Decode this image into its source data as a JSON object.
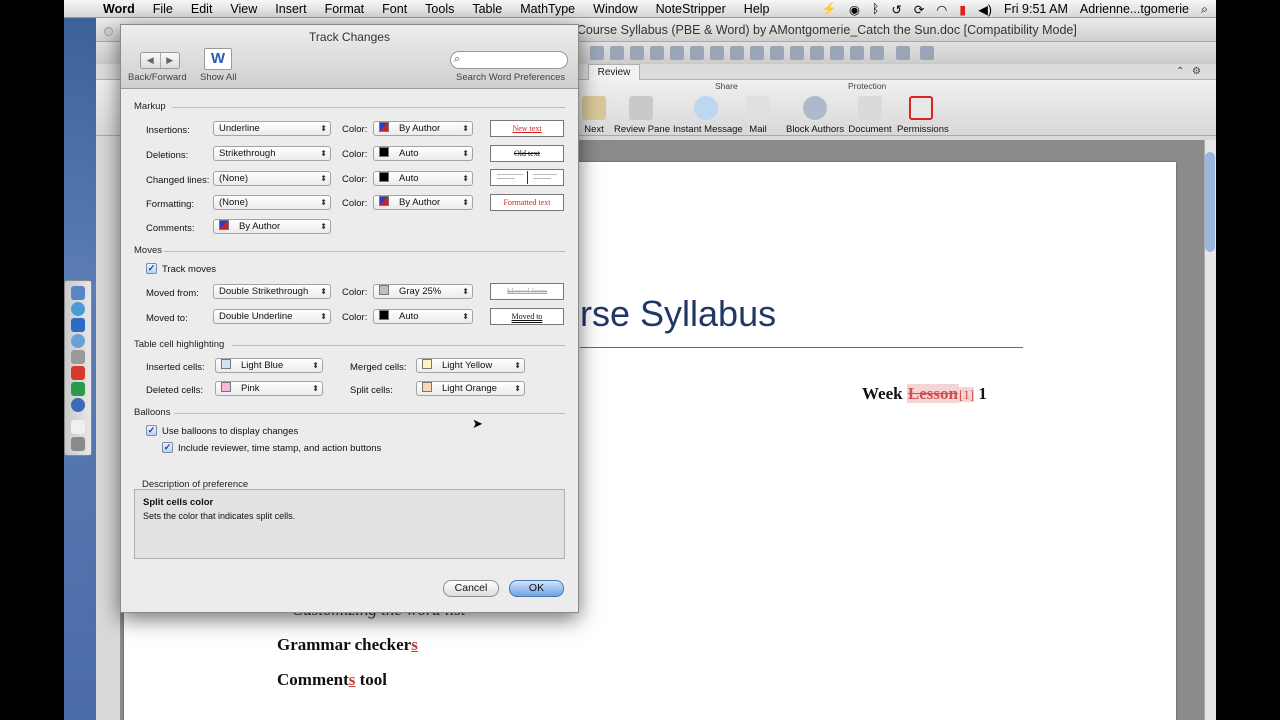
{
  "menubar": {
    "apple": "",
    "app": "Word",
    "items": [
      "File",
      "Edit",
      "View",
      "Insert",
      "Format",
      "Font",
      "Tools",
      "Table",
      "MathType",
      "Window",
      "NoteStripper",
      "Help"
    ],
    "clock": "Fri 9:51 AM",
    "user": "Adrienne...tgomerie"
  },
  "window": {
    "title": "Editing Course Syllabus (PBE & Word) by AMontgomerie_Catch the Sun.doc [Compatibility Mode]",
    "ribbon_tab": "Review",
    "groups": {
      "share": "Share",
      "protection": "Protection"
    },
    "buttons": {
      "next": "Next",
      "review_pane": "Review Pane",
      "instant_message": "Instant Message",
      "mail": "Mail",
      "block_authors": "Block Authors",
      "document": "Document",
      "permissions": "Permissions"
    }
  },
  "document": {
    "title_fragment": "rse Syllabus",
    "week": "Week ",
    "lesson": "Lesson",
    "ref": "[1]",
    "week_num": " 1",
    "customizing": "Customizing the word list",
    "grammar": "Grammar checker",
    "grammar_ins": "s",
    "comments": "Comment",
    "comments_ins": "s",
    "comments_tail": " tool"
  },
  "dialog": {
    "title": "Track Changes",
    "nav_label": "Back/Forward",
    "show_all_label": "Show All",
    "search_label": "Search Word Preferences",
    "search_placeholder": "",
    "markup": {
      "section": "Markup",
      "color_label": "Color:",
      "insertions": {
        "label": "Insertions:",
        "style": "Underline",
        "color": "By Author",
        "preview": "New text"
      },
      "deletions": {
        "label": "Deletions:",
        "style": "Strikethrough",
        "color": "Auto",
        "preview": "Old text"
      },
      "changed_lines": {
        "label": "Changed lines:",
        "style": "(None)",
        "color": "Auto"
      },
      "formatting": {
        "label": "Formatting:",
        "style": "(None)",
        "color": "By Author",
        "preview": "Formatted text"
      },
      "comments": {
        "label": "Comments:",
        "color": "By Author"
      }
    },
    "moves": {
      "section": "Moves",
      "track_moves": "Track moves",
      "moved_from": {
        "label": "Moved from:",
        "style": "Double Strikethrough",
        "color": "Gray 25%",
        "preview": "Moved from"
      },
      "moved_to": {
        "label": "Moved to:",
        "style": "Double Underline",
        "color": "Auto",
        "preview": "Moved to"
      }
    },
    "table_cells": {
      "section": "Table cell highlighting",
      "inserted": {
        "label": "Inserted cells:",
        "value": "Light Blue"
      },
      "deleted": {
        "label": "Deleted cells:",
        "value": "Pink"
      },
      "merged": {
        "label": "Merged cells:",
        "value": "Light Yellow"
      },
      "split": {
        "label": "Split cells:",
        "value": "Light Orange"
      }
    },
    "balloons": {
      "section": "Balloons",
      "use_balloons": "Use balloons to display changes",
      "include_reviewer": "Include reviewer, time stamp, and action buttons"
    },
    "description": {
      "section": "Description of preference",
      "heading": "Split cells color",
      "text": "Sets the color that indicates split cells."
    },
    "cancel": "Cancel",
    "ok": "OK"
  },
  "colors": {
    "by_author_a": "#1f3fd8",
    "by_author_b": "#d81f1f",
    "auto": "#000000",
    "gray25": "#bfbfbf",
    "light_blue": "#cfe3fb",
    "pink": "#f7b7d8",
    "light_yellow": "#fff5c0",
    "light_orange": "#fbd6ae",
    "insert_red": "#c23b3b"
  }
}
